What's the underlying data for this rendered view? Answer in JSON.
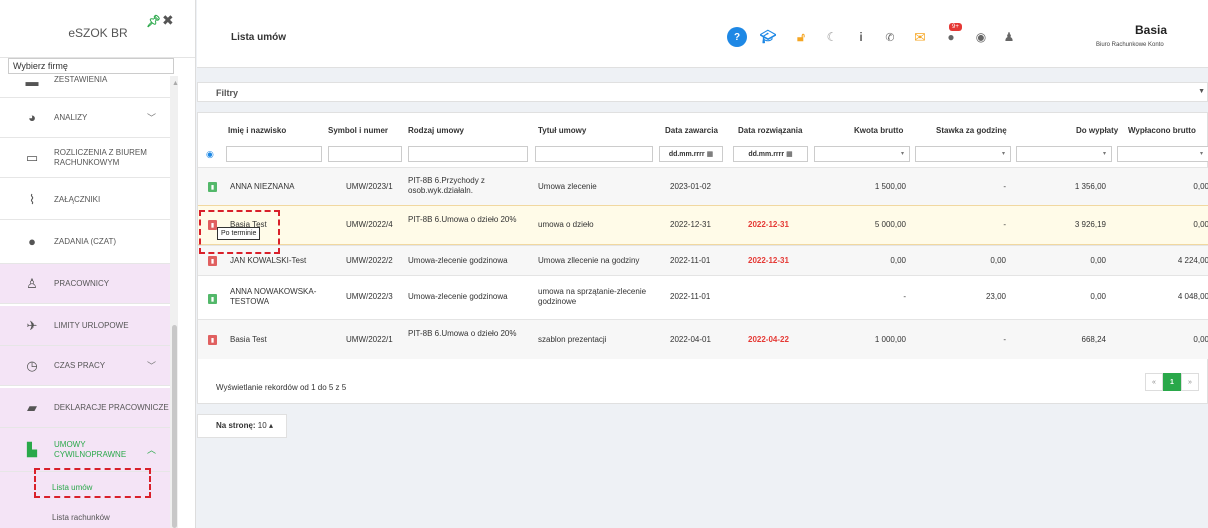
{
  "sidebar": {
    "app_title": "eSZOK BR",
    "firm_placeholder": "Wybierz firmę",
    "items": [
      {
        "label": "ZESTAWIENIA",
        "icon": "report-icon"
      },
      {
        "label": "ANALIZY",
        "icon": "pie-chart-icon"
      },
      {
        "label": "ROZLICZENIA Z BIUREM RACHUNKOWYM",
        "icon": "card-icon"
      },
      {
        "label": "ZAŁĄCZNIKI",
        "icon": "paperclip-icon"
      },
      {
        "label": "ZADANIA (CZAT)",
        "icon": "chat-icon"
      },
      {
        "label": "PRACOWNICY",
        "icon": "person-icon"
      },
      {
        "label": "LIMITY URLOPOWE",
        "icon": "plane-icon"
      },
      {
        "label": "CZAS PRACY",
        "icon": "clock-icon"
      },
      {
        "label": "DEKLARACJE PRACOWNICZE",
        "icon": "book-icon"
      },
      {
        "label": "UMOWY CYWILNOPRAWNE",
        "icon": "contract-icon"
      }
    ],
    "sub_items": [
      "Lista umów",
      "Lista rachunków"
    ]
  },
  "header": {
    "title": "Lista umów",
    "notification_count": "9+",
    "user_name": "Basia",
    "user_role": "Biuro Rachunkowe Konto"
  },
  "filters": {
    "label": "Filtry"
  },
  "table": {
    "columns": [
      "Imię i nazwisko",
      "Symbol i numer",
      "Rodzaj umowy",
      "Tytuł umowy",
      "Data zawarcia",
      "Data rozwiązania",
      "Kwota brutto",
      "Stawka za godzinę",
      "Do wypłaty",
      "Wypłacono brutto"
    ],
    "date_placeholder": "dd.mm.rrrr",
    "rows": [
      {
        "status": "green",
        "name": "ANNA NIEZNANA",
        "symbol": "UMW/2023/1",
        "type": "PIT-8B 6.Przychody z osob.wyk.działaln.",
        "title": "Umowa zlecenie",
        "signed": "2023-01-02",
        "end": "",
        "gross": "1 500,00",
        "rate": "-",
        "payout": "1 356,00",
        "paid": "0,00"
      },
      {
        "status": "red",
        "name": "Basia Test",
        "symbol": "UMW/2022/4",
        "type": "PIT-8B 6.Umowa o dzieło 20%",
        "title": "umowa o dzieło",
        "signed": "2022-12-31",
        "end": "2022-12-31",
        "gross": "5 000,00",
        "rate": "-",
        "payout": "3 926,19",
        "paid": "0,00"
      },
      {
        "status": "red",
        "name": "JAN KOWALSKI-Test",
        "symbol": "UMW/2022/2",
        "type": "Umowa-zlecenie godzinowa",
        "title": "Umowa zllecenie na godziny",
        "signed": "2022-11-01",
        "end": "2022-12-31",
        "gross": "0,00",
        "rate": "0,00",
        "payout": "0,00",
        "paid": "4 224,00"
      },
      {
        "status": "green",
        "name": "ANNA NOWAKOWSKA-TESTOWA",
        "symbol": "UMW/2022/3",
        "type": "Umowa-zlecenie godzinowa",
        "title": "umowa na sprzątanie-zlecenie godzinowe",
        "signed": "2022-11-01",
        "end": "",
        "gross": "-",
        "rate": "23,00",
        "payout": "0,00",
        "paid": "4 048,00"
      },
      {
        "status": "red",
        "name": "Basia Test",
        "symbol": "UMW/2022/1",
        "type": "PIT-8B 6.Umowa o dzieło 20%",
        "title": "szablon prezentacji",
        "signed": "2022-04-01",
        "end": "2022-04-22",
        "gross": "1 000,00",
        "rate": "-",
        "payout": "668,24",
        "paid": "0,00"
      }
    ],
    "footer": "Wyświetlanie rekordów od 1 do 5 z 5",
    "tooltip": "Po terminie",
    "pager": [
      "«",
      "1",
      "»"
    ]
  },
  "per_page": {
    "label": "Na stronę:",
    "value": "10"
  },
  "colors": {
    "accent": "#2aa84a",
    "danger": "#e53935",
    "highlight": "#fffbe8",
    "submenu": "#f4e4f6"
  }
}
